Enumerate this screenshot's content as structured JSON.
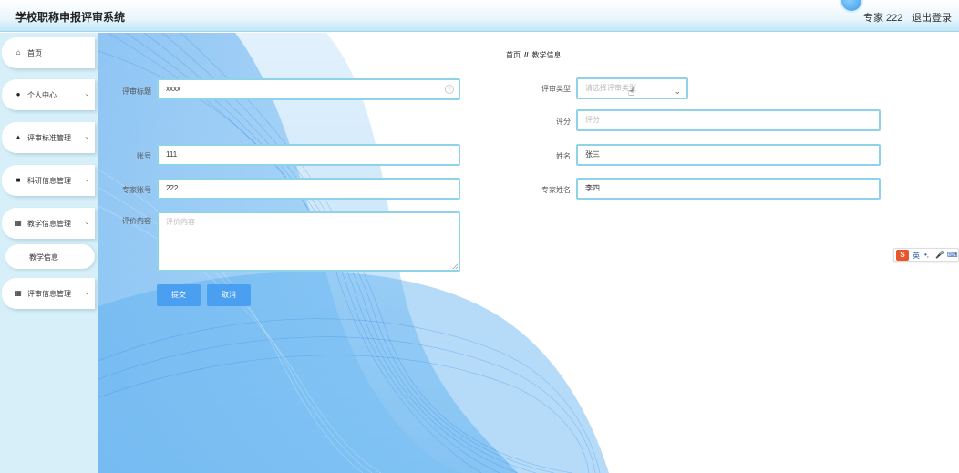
{
  "app": {
    "title": "学校职称申报评审系统"
  },
  "header": {
    "user": "专家 222",
    "logout": "退出登录"
  },
  "sidebar": {
    "items": [
      {
        "label": "首页",
        "icon": "home-icon"
      },
      {
        "label": "个人中心",
        "icon": "user-icon"
      },
      {
        "label": "评审标准管理",
        "icon": "thumbs-up-icon"
      },
      {
        "label": "科研信息管理",
        "icon": "video-icon"
      },
      {
        "label": "教学信息管理",
        "icon": "grid-icon"
      },
      {
        "label": "评审信息管理",
        "icon": "grid-icon"
      }
    ],
    "sub_item": "教学信息"
  },
  "breadcrumb": {
    "home": "首页",
    "separator": "//",
    "current": "教学信息"
  },
  "form": {
    "review_title": {
      "label": "评审标题",
      "value": "xxxx"
    },
    "review_type": {
      "label": "评审类型",
      "placeholder": "请选择评审类型"
    },
    "score": {
      "label": "评分",
      "placeholder": "评分"
    },
    "account": {
      "label": "账号",
      "value": "111"
    },
    "name": {
      "label": "姓名",
      "value": "张三"
    },
    "expert_account": {
      "label": "专家账号",
      "value": "222"
    },
    "expert_name": {
      "label": "专家姓名",
      "value": "李四"
    },
    "review_content": {
      "label": "评价内容",
      "placeholder": "评价内容"
    },
    "submit": "提交",
    "cancel": "取消"
  },
  "ime": {
    "lang": "英",
    "punct": "•,",
    "mic": "🎤",
    "keyboard": "⌨"
  },
  "colors": {
    "accent": "#4a9ff0",
    "input_border": "#8fd3ea",
    "sidebar_bg": "#d6eff8"
  }
}
